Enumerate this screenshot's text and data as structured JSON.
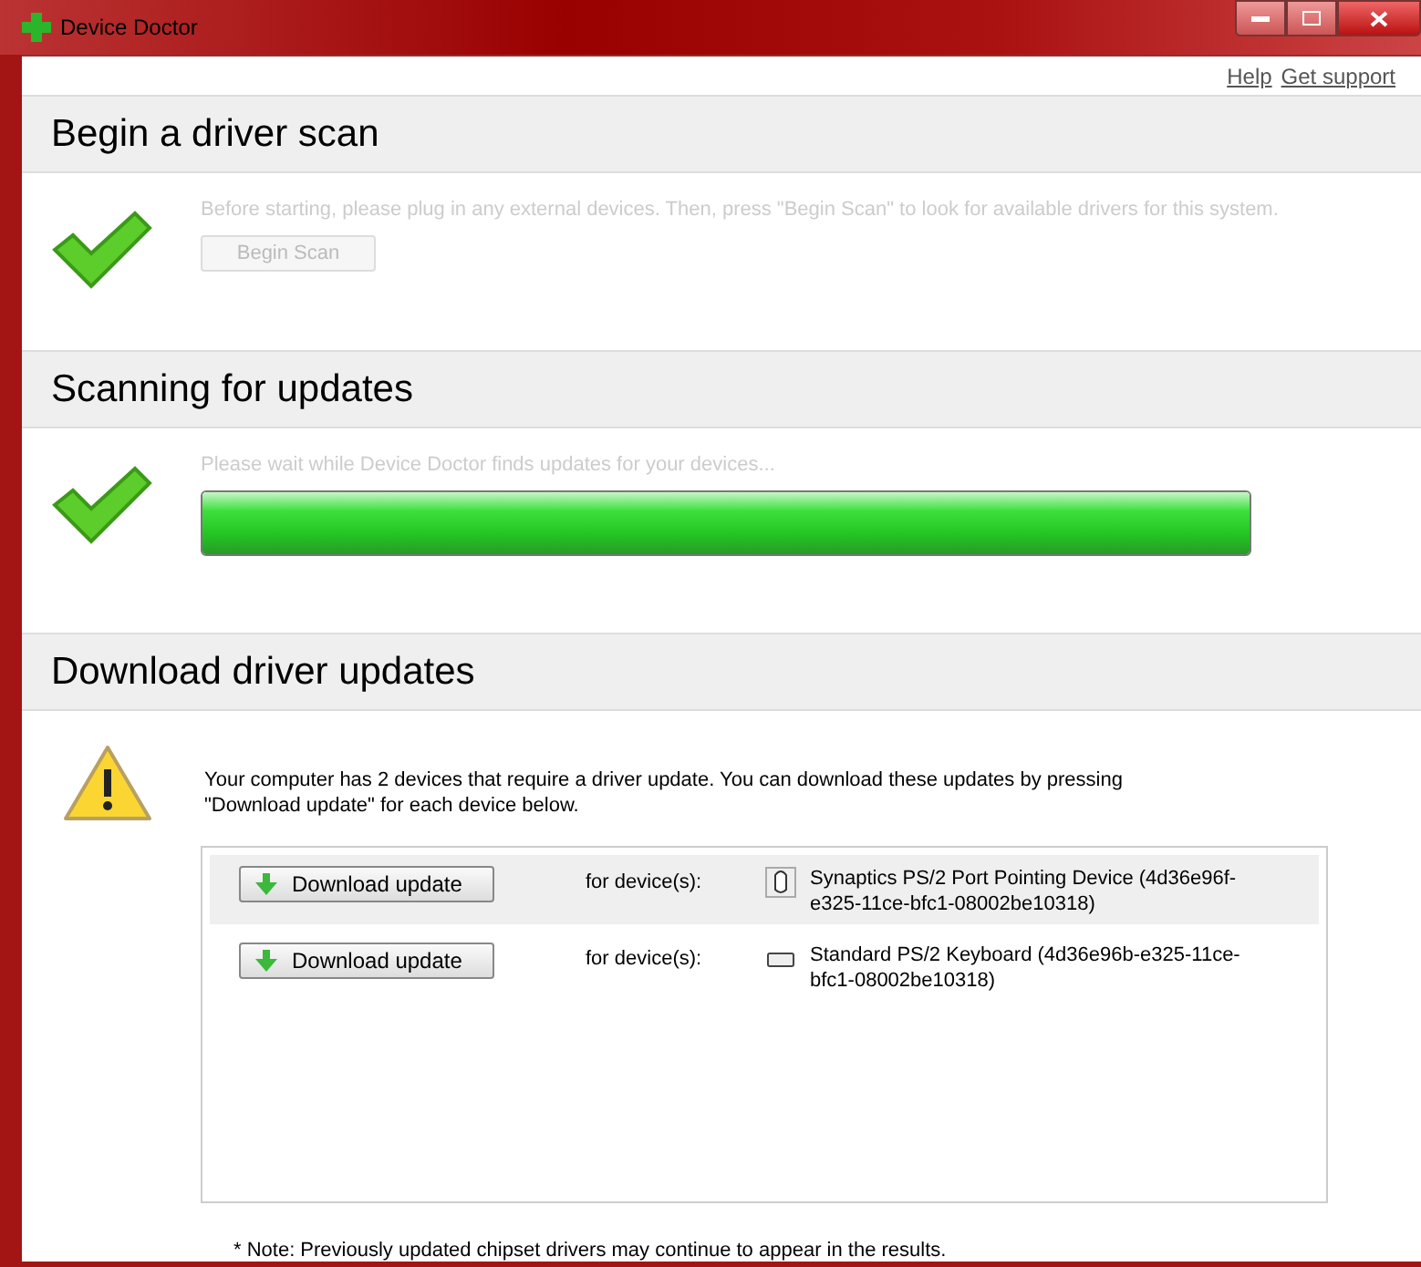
{
  "window": {
    "title": "Device Doctor"
  },
  "links": [
    "Help",
    "Get support"
  ],
  "scan": {
    "heading": "Begin a driver scan",
    "message": "Before starting, please plug in any external devices. Then, press \"Begin Scan\" to look for available drivers for this system.",
    "button": "Begin Scan",
    "disabled": true
  },
  "scanning": {
    "heading": "Scanning for updates",
    "message": "Please wait while Device Doctor finds updates for your devices...",
    "level": 1,
    "disabled": true
  },
  "download": {
    "heading": "Download driver updates",
    "message": "Your computer has 2 devices that require a driver update. You can download these updates by pressing \"Download update\" for each device below.",
    "rows": [
      {
        "button": "Download update",
        "for_label": "for device(s):",
        "kind": "mouse",
        "device": "Synaptics PS/2 Port Pointing Device (4d36e96f-e325-11ce-bfc1-08002be10318)",
        "selected": true
      },
      {
        "button": "Download update",
        "for_label": "for device(s):",
        "kind": "keyboard",
        "device": "Standard PS/2 Keyboard (4d36e96b-e325-11ce-bfc1-08002be10318)",
        "selected": false
      }
    ],
    "note": "* Note: Previously updated chipset drivers may continue to appear in the results."
  }
}
